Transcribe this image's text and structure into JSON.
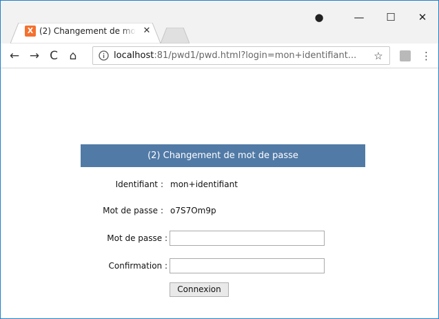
{
  "browser": {
    "tab": {
      "title": "(2) Changement de mot de passe",
      "favicon_letter": "X",
      "favicon_color": "#f4712f",
      "close_glyph": "✕"
    },
    "window_controls": {
      "user_glyph": "●",
      "minimize_glyph": "—",
      "maximize_glyph": "☐",
      "close_glyph": "✕"
    },
    "toolbar": {
      "back_glyph": "←",
      "forward_glyph": "→",
      "reload_glyph": "C",
      "home_glyph": "⌂",
      "url_host": "localhost",
      "url_rest": ":81/pwd1/pwd.html?login=mon+identifiant...",
      "star_glyph": "☆",
      "menu_glyph": "⋮"
    }
  },
  "form": {
    "header": "(2) Changement de mot de passe",
    "header_color": "#517aa6",
    "identifiant_label": "Identifiant",
    "identifiant_value": "mon+identifiant",
    "current_password_label": "Mot de passe",
    "current_password_value": "o7S7Om9p",
    "new_password_label": "Mot de passe :",
    "new_password_value": "",
    "confirmation_label": "Confirmation :",
    "confirmation_value": "",
    "colon": ":",
    "submit_label": "Connexion"
  }
}
